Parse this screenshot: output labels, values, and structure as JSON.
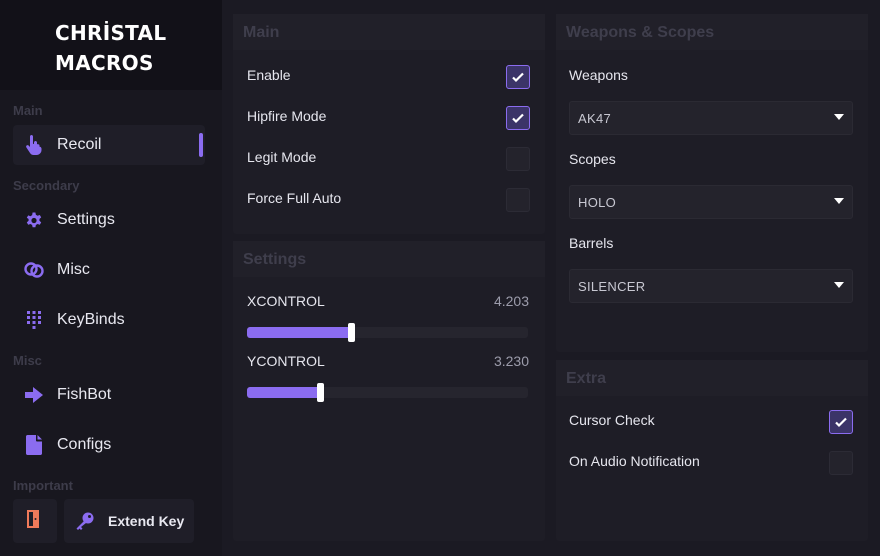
{
  "brand": {
    "line1": "CHRİSTAL",
    "line2": "MACROS"
  },
  "sidebar": {
    "sections": {
      "main": "Main",
      "secondary": "Secondary",
      "misc": "Misc",
      "important": "Important"
    },
    "items": [
      {
        "label": "Recoil",
        "icon": "hand-pointer-icon",
        "active": true
      },
      {
        "label": "Settings",
        "icon": "gear-icon"
      },
      {
        "label": "Misc",
        "icon": "link-icon"
      },
      {
        "label": "KeyBinds",
        "icon": "keypad-icon"
      },
      {
        "label": "FishBot",
        "icon": "arrow-right-icon"
      },
      {
        "label": "Configs",
        "icon": "file-icon"
      }
    ],
    "extend_key": {
      "label": "Extend Key",
      "icon": "key-icon"
    },
    "logout_icon": "door-exit-icon"
  },
  "main_panel": {
    "title": "Main",
    "options": [
      {
        "label": "Enable",
        "checked": true
      },
      {
        "label": "Hipfire Mode",
        "checked": true
      },
      {
        "label": "Legit Mode",
        "checked": false
      },
      {
        "label": "Force Full Auto",
        "checked": false
      }
    ]
  },
  "settings_panel": {
    "title": "Settings",
    "sliders": [
      {
        "label": "XCONTROL",
        "value": "4.203",
        "fill": 0.37
      },
      {
        "label": "YCONTROL",
        "value": "3.230",
        "fill": 0.26
      }
    ]
  },
  "weapons_panel": {
    "title": "Weapons & Scopes",
    "fields": [
      {
        "label": "Weapons",
        "value": "AK47"
      },
      {
        "label": "Scopes",
        "value": "HOLO"
      },
      {
        "label": "Barrels",
        "value": "SILENCER"
      }
    ]
  },
  "extra_panel": {
    "title": "Extra",
    "options": [
      {
        "label": "Cursor Check",
        "checked": true
      },
      {
        "label": "On Audio Notification",
        "checked": false
      }
    ]
  },
  "colors": {
    "accent": "#8b6cf0",
    "background": "#1b1a23",
    "panel": "#1e1d26",
    "logout": "#f07a5a"
  }
}
